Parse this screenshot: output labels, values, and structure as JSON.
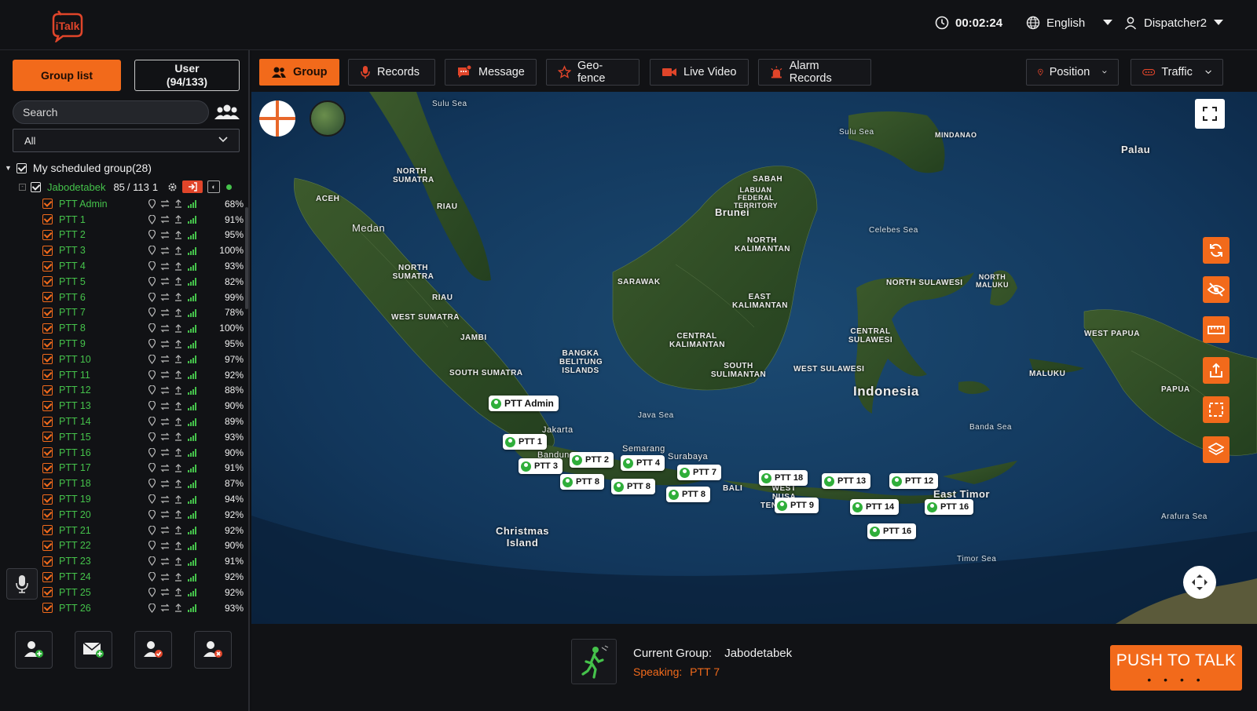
{
  "header": {
    "logo_text": "iTalk",
    "timer": "00:02:24",
    "language": "English",
    "user": "Dispatcher2"
  },
  "sidebar": {
    "tab_group": "Group list",
    "tab_user_line1": "User",
    "tab_user_line2": "(94/133)",
    "search_placeholder": "Search",
    "filter_value": "All",
    "root_group": "My scheduled group(28)",
    "group": {
      "name": "Jabodetabek",
      "online": "85",
      "total": "/ 113",
      "extra": "1"
    },
    "members": [
      {
        "name": "PTT Admin",
        "battery": "68%"
      },
      {
        "name": "PTT 1",
        "battery": "91%"
      },
      {
        "name": "PTT 2",
        "battery": "95%"
      },
      {
        "name": "PTT 3",
        "battery": "100%"
      },
      {
        "name": "PTT 4",
        "battery": "93%"
      },
      {
        "name": "PTT 5",
        "battery": "82%"
      },
      {
        "name": "PTT 6",
        "battery": "99%"
      },
      {
        "name": "PTT 7",
        "battery": "78%"
      },
      {
        "name": "PTT 8",
        "battery": "100%"
      },
      {
        "name": "PTT 9",
        "battery": "95%"
      },
      {
        "name": "PTT 10",
        "battery": "97%"
      },
      {
        "name": "PTT 11",
        "battery": "92%"
      },
      {
        "name": "PTT 12",
        "battery": "88%"
      },
      {
        "name": "PTT 13",
        "battery": "90%"
      },
      {
        "name": "PTT 14",
        "battery": "89%"
      },
      {
        "name": "PTT 15",
        "battery": "93%"
      },
      {
        "name": "PTT 16",
        "battery": "90%"
      },
      {
        "name": "PTT 17",
        "battery": "91%"
      },
      {
        "name": "PTT 18",
        "battery": "87%"
      },
      {
        "name": "PTT 19",
        "battery": "94%"
      },
      {
        "name": "PTT 20",
        "battery": "92%"
      },
      {
        "name": "PTT 21",
        "battery": "92%"
      },
      {
        "name": "PTT 22",
        "battery": "90%"
      },
      {
        "name": "PTT 23",
        "battery": "91%"
      },
      {
        "name": "PTT 24",
        "battery": "92%"
      },
      {
        "name": "PTT 25",
        "battery": "92%"
      },
      {
        "name": "PTT 26",
        "battery": "93%"
      }
    ]
  },
  "nav": {
    "group": "Group",
    "records": "Records",
    "message": "Message",
    "geofence": "Geo-fence",
    "live_video": "Live Video",
    "alarm_records": "Alarm Records",
    "position": "Position",
    "traffic": "Traffic"
  },
  "map": {
    "labels": {
      "aceh": "ACEH",
      "medan": "Medan",
      "north_sumatra": "NORTH SUMATRA",
      "riau": "RIAU",
      "riau2": "RIAU",
      "west_sumatra": "WEST SUMATRA",
      "jambi": "JAMBI",
      "south_sumatra": "SOUTH SUMATRA",
      "bangka": "BANGKA BELITUNG ISLANDS",
      "sarawak": "SARAWAK",
      "brunei": "Brunei",
      "sabah": "SABAH",
      "labuan": "LABUAN FEDERAL TERRITORY",
      "north_kal": "NORTH KALIMANTAN",
      "east_kal": "EAST KALIMANTAN",
      "central_kal": "CENTRAL KALIMANTAN",
      "south_kal": "SOUTH SULIMANTAN",
      "java_sea": "Java Sea",
      "jakarta": "Jakarta",
      "bandung": "Bandung",
      "semarang": "Semarang",
      "surabaya": "Surabaya",
      "bali": "BALI",
      "west_nusa": "WEST NUSA TENGGARA",
      "christmas": "Christmas Island",
      "indonesia": "Indonesia",
      "celebes": "Celebes Sea",
      "sulu": "Sulu Sea",
      "mindanao": "MINDANAO",
      "palau": "Palau",
      "north_sulawesi": "NORTH SULAWESI",
      "maluku_n": "NORTH MALUKU",
      "central_sul": "CENTRAL SULAWESI",
      "west_sul": "WEST SULAWESI",
      "maluku": "MALUKU",
      "west_papua": "WEST PAPUA",
      "papua": "PAPUA",
      "banda": "Banda Sea",
      "east_timor": "East Timor",
      "timor_sea": "Timor Sea",
      "arafura": "Arafura Sea"
    },
    "markers": [
      "PTT Admin",
      "PTT 1",
      "PTT 2",
      "PTT 3",
      "PTT 4",
      "PTT 8",
      "PTT 8",
      "PTT 7",
      "PTT 8",
      "PTT 18",
      "PTT 9",
      "PTT 13",
      "PTT 14",
      "PTT 12",
      "PTT 16",
      "PTT 16"
    ]
  },
  "footer": {
    "current_group_label": "Current Group:",
    "current_group_value": "Jabodetabek",
    "speaking_label": "Speaking:",
    "speaking_value": "PTT 7",
    "ptt_label": "PUSH TO TALK",
    "ptt_dots": "• • • •"
  },
  "colors": {
    "accent": "#f26a1b",
    "online": "#45c24b",
    "background": "#111215"
  }
}
